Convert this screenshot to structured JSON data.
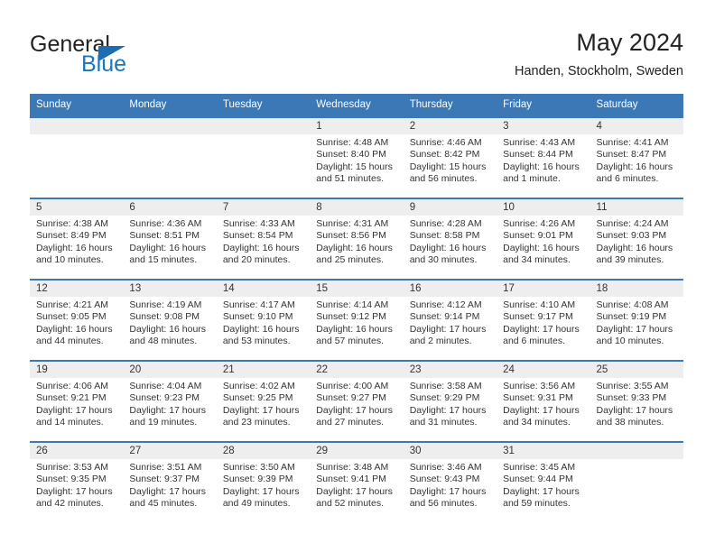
{
  "brand": {
    "word1": "General",
    "word2": "Blue",
    "flag_icon": "triangle-flag-icon",
    "accent_color": "#1b75bb"
  },
  "header": {
    "title": "May 2024",
    "subtitle": "Handen, Stockholm, Sweden"
  },
  "theme": {
    "header_bg": "#3b78b5",
    "header_text": "#ffffff",
    "daynum_band_bg": "#eeeeee",
    "row_border": "#3b78b5",
    "body_text": "#333333"
  },
  "calendar": {
    "weekday_headers": [
      "Sunday",
      "Monday",
      "Tuesday",
      "Wednesday",
      "Thursday",
      "Friday",
      "Saturday"
    ],
    "labels": {
      "sunrise": "Sunrise:",
      "sunset": "Sunset:",
      "daylight": "Daylight:"
    },
    "weeks": [
      [
        {
          "day": "",
          "empty": true
        },
        {
          "day": "",
          "empty": true
        },
        {
          "day": "",
          "empty": true
        },
        {
          "day": "1",
          "sunrise": "Sunrise: 4:48 AM",
          "sunset": "Sunset: 8:40 PM",
          "daylight1": "Daylight: 15 hours",
          "daylight2": "and 51 minutes."
        },
        {
          "day": "2",
          "sunrise": "Sunrise: 4:46 AM",
          "sunset": "Sunset: 8:42 PM",
          "daylight1": "Daylight: 15 hours",
          "daylight2": "and 56 minutes."
        },
        {
          "day": "3",
          "sunrise": "Sunrise: 4:43 AM",
          "sunset": "Sunset: 8:44 PM",
          "daylight1": "Daylight: 16 hours",
          "daylight2": "and 1 minute."
        },
        {
          "day": "4",
          "sunrise": "Sunrise: 4:41 AM",
          "sunset": "Sunset: 8:47 PM",
          "daylight1": "Daylight: 16 hours",
          "daylight2": "and 6 minutes."
        }
      ],
      [
        {
          "day": "5",
          "sunrise": "Sunrise: 4:38 AM",
          "sunset": "Sunset: 8:49 PM",
          "daylight1": "Daylight: 16 hours",
          "daylight2": "and 10 minutes."
        },
        {
          "day": "6",
          "sunrise": "Sunrise: 4:36 AM",
          "sunset": "Sunset: 8:51 PM",
          "daylight1": "Daylight: 16 hours",
          "daylight2": "and 15 minutes."
        },
        {
          "day": "7",
          "sunrise": "Sunrise: 4:33 AM",
          "sunset": "Sunset: 8:54 PM",
          "daylight1": "Daylight: 16 hours",
          "daylight2": "and 20 minutes."
        },
        {
          "day": "8",
          "sunrise": "Sunrise: 4:31 AM",
          "sunset": "Sunset: 8:56 PM",
          "daylight1": "Daylight: 16 hours",
          "daylight2": "and 25 minutes."
        },
        {
          "day": "9",
          "sunrise": "Sunrise: 4:28 AM",
          "sunset": "Sunset: 8:58 PM",
          "daylight1": "Daylight: 16 hours",
          "daylight2": "and 30 minutes."
        },
        {
          "day": "10",
          "sunrise": "Sunrise: 4:26 AM",
          "sunset": "Sunset: 9:01 PM",
          "daylight1": "Daylight: 16 hours",
          "daylight2": "and 34 minutes."
        },
        {
          "day": "11",
          "sunrise": "Sunrise: 4:24 AM",
          "sunset": "Sunset: 9:03 PM",
          "daylight1": "Daylight: 16 hours",
          "daylight2": "and 39 minutes."
        }
      ],
      [
        {
          "day": "12",
          "sunrise": "Sunrise: 4:21 AM",
          "sunset": "Sunset: 9:05 PM",
          "daylight1": "Daylight: 16 hours",
          "daylight2": "and 44 minutes."
        },
        {
          "day": "13",
          "sunrise": "Sunrise: 4:19 AM",
          "sunset": "Sunset: 9:08 PM",
          "daylight1": "Daylight: 16 hours",
          "daylight2": "and 48 minutes."
        },
        {
          "day": "14",
          "sunrise": "Sunrise: 4:17 AM",
          "sunset": "Sunset: 9:10 PM",
          "daylight1": "Daylight: 16 hours",
          "daylight2": "and 53 minutes."
        },
        {
          "day": "15",
          "sunrise": "Sunrise: 4:14 AM",
          "sunset": "Sunset: 9:12 PM",
          "daylight1": "Daylight: 16 hours",
          "daylight2": "and 57 minutes."
        },
        {
          "day": "16",
          "sunrise": "Sunrise: 4:12 AM",
          "sunset": "Sunset: 9:14 PM",
          "daylight1": "Daylight: 17 hours",
          "daylight2": "and 2 minutes."
        },
        {
          "day": "17",
          "sunrise": "Sunrise: 4:10 AM",
          "sunset": "Sunset: 9:17 PM",
          "daylight1": "Daylight: 17 hours",
          "daylight2": "and 6 minutes."
        },
        {
          "day": "18",
          "sunrise": "Sunrise: 4:08 AM",
          "sunset": "Sunset: 9:19 PM",
          "daylight1": "Daylight: 17 hours",
          "daylight2": "and 10 minutes."
        }
      ],
      [
        {
          "day": "19",
          "sunrise": "Sunrise: 4:06 AM",
          "sunset": "Sunset: 9:21 PM",
          "daylight1": "Daylight: 17 hours",
          "daylight2": "and 14 minutes."
        },
        {
          "day": "20",
          "sunrise": "Sunrise: 4:04 AM",
          "sunset": "Sunset: 9:23 PM",
          "daylight1": "Daylight: 17 hours",
          "daylight2": "and 19 minutes."
        },
        {
          "day": "21",
          "sunrise": "Sunrise: 4:02 AM",
          "sunset": "Sunset: 9:25 PM",
          "daylight1": "Daylight: 17 hours",
          "daylight2": "and 23 minutes."
        },
        {
          "day": "22",
          "sunrise": "Sunrise: 4:00 AM",
          "sunset": "Sunset: 9:27 PM",
          "daylight1": "Daylight: 17 hours",
          "daylight2": "and 27 minutes."
        },
        {
          "day": "23",
          "sunrise": "Sunrise: 3:58 AM",
          "sunset": "Sunset: 9:29 PM",
          "daylight1": "Daylight: 17 hours",
          "daylight2": "and 31 minutes."
        },
        {
          "day": "24",
          "sunrise": "Sunrise: 3:56 AM",
          "sunset": "Sunset: 9:31 PM",
          "daylight1": "Daylight: 17 hours",
          "daylight2": "and 34 minutes."
        },
        {
          "day": "25",
          "sunrise": "Sunrise: 3:55 AM",
          "sunset": "Sunset: 9:33 PM",
          "daylight1": "Daylight: 17 hours",
          "daylight2": "and 38 minutes."
        }
      ],
      [
        {
          "day": "26",
          "sunrise": "Sunrise: 3:53 AM",
          "sunset": "Sunset: 9:35 PM",
          "daylight1": "Daylight: 17 hours",
          "daylight2": "and 42 minutes."
        },
        {
          "day": "27",
          "sunrise": "Sunrise: 3:51 AM",
          "sunset": "Sunset: 9:37 PM",
          "daylight1": "Daylight: 17 hours",
          "daylight2": "and 45 minutes."
        },
        {
          "day": "28",
          "sunrise": "Sunrise: 3:50 AM",
          "sunset": "Sunset: 9:39 PM",
          "daylight1": "Daylight: 17 hours",
          "daylight2": "and 49 minutes."
        },
        {
          "day": "29",
          "sunrise": "Sunrise: 3:48 AM",
          "sunset": "Sunset: 9:41 PM",
          "daylight1": "Daylight: 17 hours",
          "daylight2": "and 52 minutes."
        },
        {
          "day": "30",
          "sunrise": "Sunrise: 3:46 AM",
          "sunset": "Sunset: 9:43 PM",
          "daylight1": "Daylight: 17 hours",
          "daylight2": "and 56 minutes."
        },
        {
          "day": "31",
          "sunrise": "Sunrise: 3:45 AM",
          "sunset": "Sunset: 9:44 PM",
          "daylight1": "Daylight: 17 hours",
          "daylight2": "and 59 minutes."
        },
        {
          "day": "",
          "empty": true
        }
      ]
    ]
  }
}
